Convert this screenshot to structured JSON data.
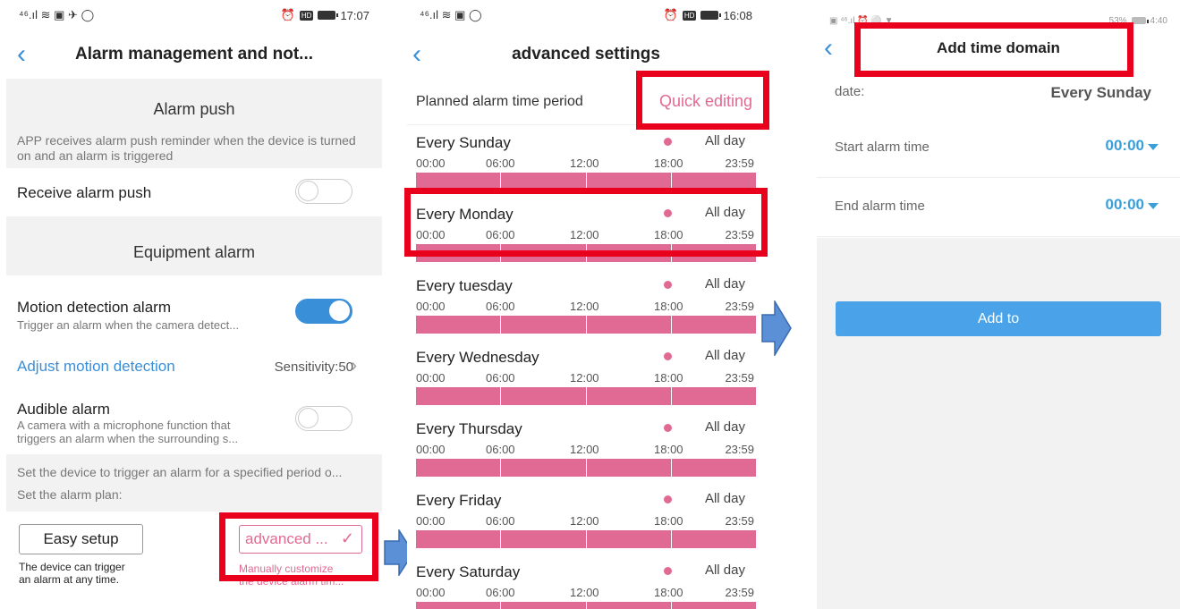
{
  "colors": {
    "accent_blue": "#3a8fd9",
    "pink": "#e06a93",
    "highlight_red": "#e8001c",
    "add_button": "#4aa3e8"
  },
  "screen1": {
    "status": {
      "left_icons": "⁴⁶.ıl ≋ ▣ ✈ ◯",
      "time": "17:07"
    },
    "title": "Alarm management and not...",
    "alarm_push": {
      "heading": "Alarm push",
      "description": "APP receives alarm push reminder when the device is turned on and an alarm is triggered",
      "receive_label": "Receive alarm push",
      "receive_on": false
    },
    "equipment_alarm": {
      "heading": "Equipment alarm"
    },
    "motion": {
      "label": "Motion detection alarm",
      "sub": "Trigger an alarm when the camera detect...",
      "on": true
    },
    "adjust": {
      "label": "Adjust motion detection",
      "sensitivity": "Sensitivity:50"
    },
    "audible": {
      "label": "Audible alarm",
      "sub_line1": "A camera with a microphone function that",
      "sub_line2": "triggers an alarm when the surrounding s...",
      "on": false
    },
    "plan": {
      "line1": "Set the device to trigger an alarm for a specified period o...",
      "line2": "Set the alarm plan:"
    },
    "easy": {
      "label": "Easy setup",
      "desc_line1": "The device can trigger",
      "desc_line2": "an alarm at any time."
    },
    "advanced": {
      "label": "advanced ...",
      "desc_line1": "Manually customize",
      "desc_line2": "the device alarm tim..."
    }
  },
  "screen2": {
    "status": {
      "time": "16:08"
    },
    "title": "advanced settings",
    "header_label": "Planned alarm time period",
    "quick_edit": "Quick editing",
    "time_labels": [
      "00:00",
      "06:00",
      "12:00",
      "18:00",
      "23:59"
    ],
    "all_day": "All day",
    "days": [
      "Every Sunday",
      "Every Monday",
      "Every tuesday",
      "Every Wednesday",
      "Every Thursday",
      "Every Friday",
      "Every Saturday"
    ]
  },
  "screen3": {
    "status": {
      "battery": "53%",
      "time": "4:40"
    },
    "title": "Add time domain",
    "date_label": "date:",
    "date_value": "Every Sunday",
    "start_label": "Start alarm time",
    "start_value": "00:00",
    "end_label": "End alarm time",
    "end_value": "00:00",
    "add_button": "Add to"
  }
}
